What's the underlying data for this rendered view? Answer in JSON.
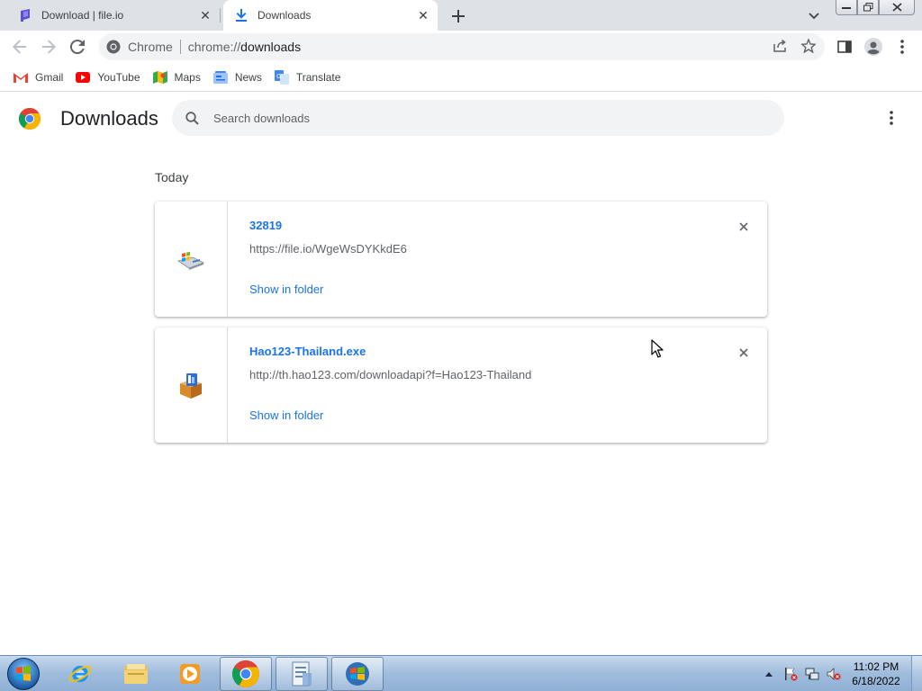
{
  "browser": {
    "tabs": [
      {
        "title": "Download | file.io",
        "favicon": "fileio-icon",
        "active": false
      },
      {
        "title": "Downloads",
        "favicon": "download-icon",
        "active": true
      }
    ],
    "omnibox": {
      "site_chip": "Chrome",
      "url_prefix": "chrome://",
      "url_host": "downloads"
    },
    "bookmarks": [
      {
        "label": "Gmail",
        "icon": "gmail-icon"
      },
      {
        "label": "YouTube",
        "icon": "youtube-icon"
      },
      {
        "label": "Maps",
        "icon": "maps-icon"
      },
      {
        "label": "News",
        "icon": "news-icon"
      },
      {
        "label": "Translate",
        "icon": "translate-icon"
      }
    ]
  },
  "downloads_page": {
    "title": "Downloads",
    "search_placeholder": "Search downloads",
    "day_label": "Today",
    "items": [
      {
        "name": "32819",
        "url": "https://file.io/WgeWsDYKkdE6",
        "action": "Show in folder",
        "icon": "windows-installer-icon"
      },
      {
        "name": "Hao123-Thailand.exe",
        "url": "http://th.hao123.com/downloadapi?f=Hao123-Thailand",
        "action": "Show in folder",
        "icon": "package-installer-icon"
      }
    ]
  },
  "taskbar": {
    "apps": [
      "internet-explorer-icon",
      "file-explorer-icon",
      "media-player-icon",
      "chrome-icon",
      "document-icon",
      "windows-icon"
    ],
    "clock_time": "11:02 PM",
    "clock_date": "6/18/2022"
  },
  "colors": {
    "accent": "#1a73e8",
    "tabstrip": "#dee1e6",
    "omnibox": "#f1f3f4"
  }
}
